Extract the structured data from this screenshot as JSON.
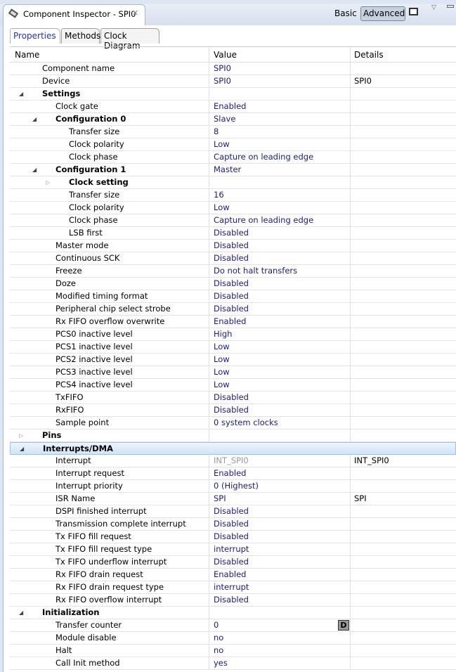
{
  "view": {
    "title": "Component Inspector - SPI0",
    "basic": "Basic",
    "advanced": "Advanced"
  },
  "tabs": [
    "Properties",
    "Methods",
    "Clock Diagram"
  ],
  "columns": {
    "name": "Name",
    "value": "Value",
    "details": "Details"
  },
  "rows": [
    {
      "n": "Component name",
      "l": 1,
      "v": "SPI0"
    },
    {
      "n": "Device",
      "l": 1,
      "v": "SPI0",
      "d": "SPI0"
    },
    {
      "n": "Settings",
      "l": 1,
      "b": 1,
      "t": "open"
    },
    {
      "n": "Clock gate",
      "l": 2,
      "v": "Enabled"
    },
    {
      "n": "Configuration 0",
      "l": 2,
      "b": 1,
      "t": "open",
      "v": "Slave"
    },
    {
      "n": "Transfer size",
      "l": 3,
      "v": "8"
    },
    {
      "n": "Clock polarity",
      "l": 3,
      "v": "Low"
    },
    {
      "n": "Clock phase",
      "l": 3,
      "v": "Capture on leading edge"
    },
    {
      "n": "Configuration 1",
      "l": 2,
      "b": 1,
      "t": "open",
      "v": "Master"
    },
    {
      "n": "Clock setting",
      "l": 3,
      "b": 1,
      "t": "closed"
    },
    {
      "n": "Transfer size",
      "l": 3,
      "v": "16"
    },
    {
      "n": "Clock polarity",
      "l": 3,
      "v": "Low"
    },
    {
      "n": "Clock phase",
      "l": 3,
      "v": "Capture on leading edge"
    },
    {
      "n": "LSB first",
      "l": 3,
      "v": "Disabled"
    },
    {
      "n": "Master mode",
      "l": 2,
      "v": "Disabled"
    },
    {
      "n": "Continuous SCK",
      "l": 2,
      "v": "Disabled"
    },
    {
      "n": "Freeze",
      "l": 2,
      "v": "Do not halt transfers"
    },
    {
      "n": "Doze",
      "l": 2,
      "v": "Disabled"
    },
    {
      "n": "Modified timing format",
      "l": 2,
      "v": "Disabled"
    },
    {
      "n": "Peripheral chip select strobe",
      "l": 2,
      "v": "Disabled"
    },
    {
      "n": "Rx FIFO overflow overwrite",
      "l": 2,
      "v": "Enabled"
    },
    {
      "n": "PCS0 inactive level",
      "l": 2,
      "v": "High"
    },
    {
      "n": "PCS1 inactive level",
      "l": 2,
      "v": "Low"
    },
    {
      "n": "PCS2 inactive level",
      "l": 2,
      "v": "Low"
    },
    {
      "n": "PCS3 inactive level",
      "l": 2,
      "v": "Low"
    },
    {
      "n": "PCS4 inactive level",
      "l": 2,
      "v": "Low"
    },
    {
      "n": "TxFIFO",
      "l": 2,
      "v": "Disabled"
    },
    {
      "n": "RxFIFO",
      "l": 2,
      "v": "Disabled"
    },
    {
      "n": "Sample point",
      "l": 2,
      "v": "0 system clocks"
    },
    {
      "n": "Pins",
      "l": 1,
      "b": 1,
      "t": "closed"
    },
    {
      "n": "Interrupts/DMA",
      "l": 1,
      "b": 1,
      "t": "open",
      "sel": 1
    },
    {
      "n": "Interrupt",
      "l": 2,
      "v": "INT_SPI0",
      "d": "INT_SPI0",
      "gray": 1
    },
    {
      "n": "Interrupt request",
      "l": 2,
      "v": "Enabled"
    },
    {
      "n": "Interrupt priority",
      "l": 2,
      "v": "0 (Highest)"
    },
    {
      "n": "ISR Name",
      "l": 2,
      "v": "SPI",
      "d": "SPI"
    },
    {
      "n": "DSPI finished interrupt",
      "l": 2,
      "v": "Disabled"
    },
    {
      "n": "Transmission complete interrupt",
      "l": 2,
      "v": "Disabled"
    },
    {
      "n": "Tx FIFO fill request",
      "l": 2,
      "v": "Disabled"
    },
    {
      "n": "Tx FIFO fill request type",
      "l": 2,
      "v": "interrupt"
    },
    {
      "n": "Tx FIFO underflow interrupt",
      "l": 2,
      "v": "Disabled"
    },
    {
      "n": "Rx FIFO drain request",
      "l": 2,
      "v": "Enabled"
    },
    {
      "n": "Rx FIFO drain request type",
      "l": 2,
      "v": "interrupt"
    },
    {
      "n": "Rx FIFO overflow interrupt",
      "l": 2,
      "v": "Disabled"
    },
    {
      "n": "Initialization",
      "l": 1,
      "b": 1,
      "t": "open"
    },
    {
      "n": "Transfer counter",
      "l": 2,
      "v": "0",
      "btn": "D"
    },
    {
      "n": "Module disable",
      "l": 2,
      "v": "no"
    },
    {
      "n": "Halt",
      "l": 2,
      "v": "no"
    },
    {
      "n": "Call Init method",
      "l": 2,
      "v": "yes"
    }
  ]
}
